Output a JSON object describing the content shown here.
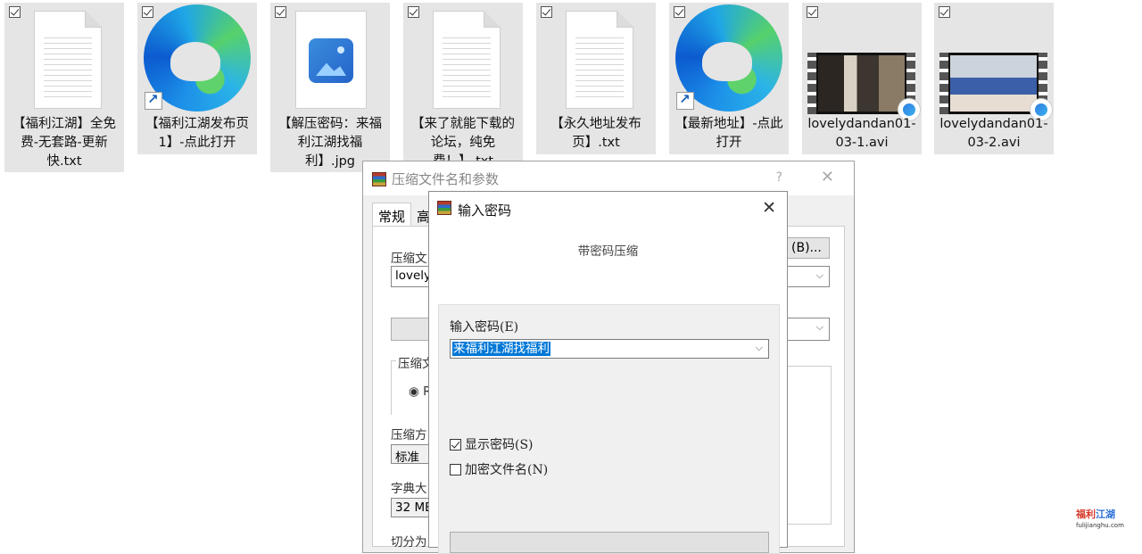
{
  "files": [
    {
      "name": "【福利江湖】全免费-无套路-更新快.txt",
      "kind": "text"
    },
    {
      "name": "【福利江湖发布页1】-点此打开",
      "kind": "edge-shortcut"
    },
    {
      "name": "【解压密码：来福利江湖找福利】.jpg",
      "kind": "image"
    },
    {
      "name": "【来了就能下载的论坛，纯免费！】.txt",
      "kind": "text"
    },
    {
      "name": "【永久地址发布页】.txt",
      "kind": "text"
    },
    {
      "name": "【最新地址】-点此打开",
      "kind": "edge-shortcut"
    },
    {
      "name": "lovelydandan01-03-1.avi",
      "kind": "video"
    },
    {
      "name": "lovelydandan01-03-2.avi",
      "kind": "video"
    }
  ],
  "archive_dialog": {
    "title": "压缩文件名和参数",
    "help": "?",
    "close": "✕",
    "tabs": [
      "常规",
      "高"
    ],
    "archive_name_label": "压缩文",
    "archive_name_value": "lovelyc",
    "browse_button": "(B)...",
    "format_label": "压缩文",
    "format_option": "RA",
    "method_label": "压缩方",
    "method_value": "标准",
    "dict_label": "字典大",
    "dict_value": "32 MB",
    "split_label": "切分为"
  },
  "password_dialog": {
    "title": "输入密码",
    "close": "✕",
    "subtitle": "带密码压缩",
    "password_label": "输入密码(E)",
    "password_value": "来福利江湖找福利",
    "show_password_label": "显示密码(S)",
    "show_password_checked": true,
    "encrypt_names_label": "加密文件名(N)",
    "encrypt_names_checked": false
  },
  "watermark": {
    "title_red": "福利",
    "title_blue": "江湖",
    "url": "fulijianghu.com"
  }
}
